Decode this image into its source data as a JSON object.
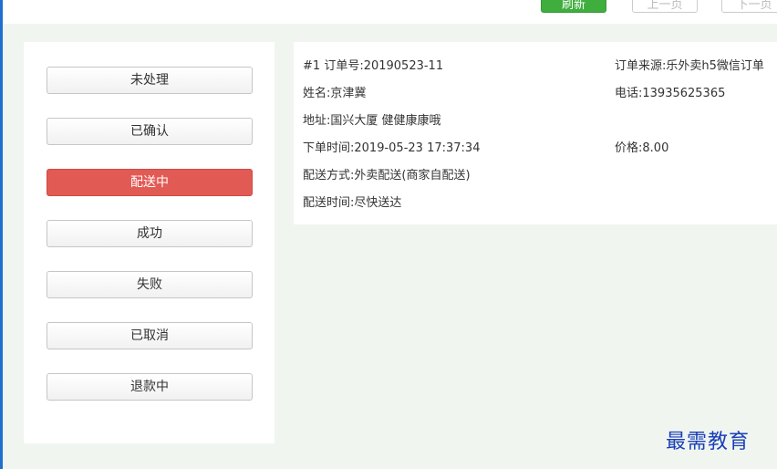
{
  "toolbar": {
    "refresh_label": "刷新",
    "prev_label": "上一页",
    "next_label": "下一页"
  },
  "status_tabs": [
    {
      "label": "未处理",
      "active": false
    },
    {
      "label": "已确认",
      "active": false
    },
    {
      "label": "配送中",
      "active": true
    },
    {
      "label": "成功",
      "active": false
    },
    {
      "label": "失败",
      "active": false
    },
    {
      "label": "已取消",
      "active": false
    },
    {
      "label": "退款中",
      "active": false
    }
  ],
  "order": {
    "index": "#1",
    "number_label": "订单号:",
    "number": "20190523-11",
    "source_label": "订单来源:",
    "source": "乐外卖h5微信订单",
    "name_label": "姓名:",
    "name": "京津冀",
    "phone_label": "电话:",
    "phone": "13935625365",
    "address_label": "地址:",
    "address": "国兴大厦 健健康康哦",
    "time_label": "下单时间:",
    "time": "2019-05-23 17:37:34",
    "price_label": "价格:",
    "price": "8.00",
    "delivery_method_label": "配送方式:",
    "delivery_method": "外卖配送(商家自配送)",
    "delivery_time_label": "配送时间:",
    "delivery_time": "尽快送达"
  },
  "watermark": "最需教育",
  "colors": {
    "active_tab": "#e25a54",
    "refresh": "#3fae3f",
    "page_bg": "#f0f5f0",
    "accent_edge": "#1f6fd0"
  }
}
